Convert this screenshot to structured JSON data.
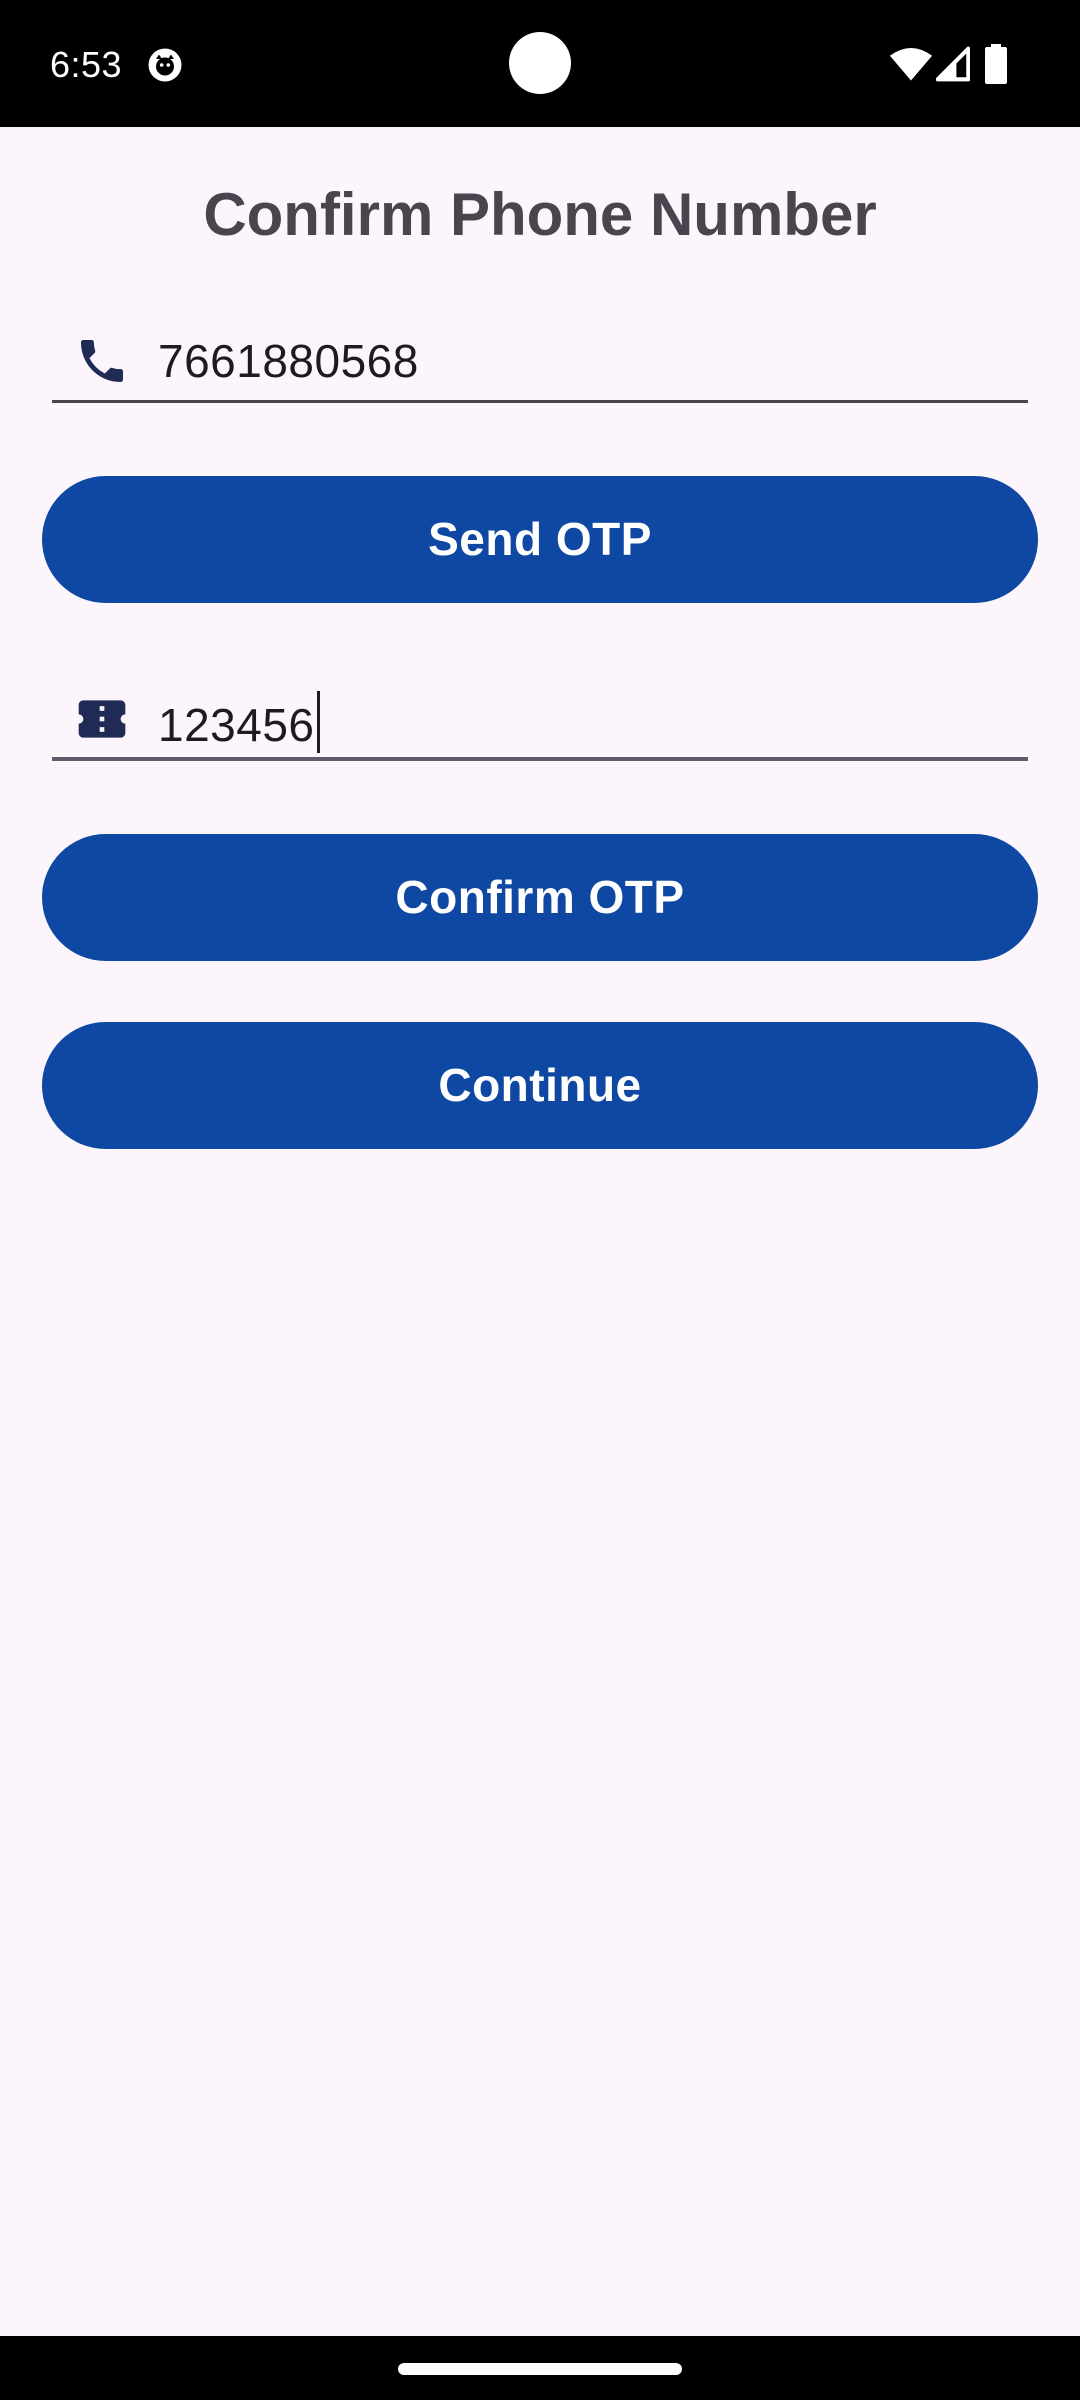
{
  "status_bar": {
    "time": "6:53",
    "app_icon": "cat-face-icon",
    "icons": [
      "wifi-icon",
      "signal-icon",
      "battery-icon"
    ]
  },
  "page": {
    "title": "Confirm Phone Number"
  },
  "phone_field": {
    "icon": "phone-icon",
    "value": "7661880568"
  },
  "send_otp_button": {
    "label": "Send OTP"
  },
  "otp_field": {
    "icon": "ticket-icon",
    "value": "123456"
  },
  "confirm_otp_button": {
    "label": "Confirm OTP"
  },
  "continue_button": {
    "label": "Continue"
  },
  "colors": {
    "background": "#fcf5fc",
    "primary": "#0f48a3",
    "icon": "#1f2a55",
    "title": "#48454f",
    "text": "#1d1b20"
  }
}
